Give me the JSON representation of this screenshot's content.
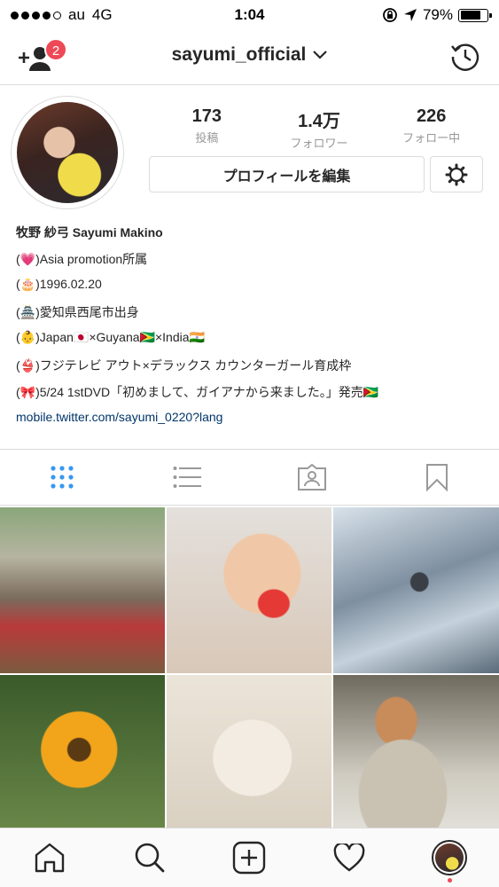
{
  "status_bar": {
    "carrier": "au",
    "network": "4G",
    "time": "1:04",
    "battery": "79%",
    "battery_level": 0.79
  },
  "header": {
    "username": "sayumi_official",
    "pending_count": "2"
  },
  "profile": {
    "stats": [
      {
        "value": "173",
        "label": "投稿"
      },
      {
        "value": "1.4万",
        "label": "フォロワー"
      },
      {
        "value": "226",
        "label": "フォロー中"
      }
    ],
    "edit_label": "プロフィールを編集",
    "name": "牧野 紗弓 Sayumi Makino",
    "bio_lines": [
      "(💗)Asia promotion所属",
      "(🎂)1996.02.20",
      "(🏯)愛知県西尾市出身",
      "(👶)Japan🇯🇵×Guyana🇬🇾×India🇮🇳",
      "(👙)フジテレビ アウト×デラックス カウンターガール育成枠",
      "(🎀)5/24 1stDVD「初めまして、ガイアナから来ました。」発売🇬🇾"
    ],
    "link": "mobile.twitter.com/sayumi_0220?lang"
  },
  "tabs": [
    "grid-icon",
    "list-icon",
    "tagged-icon",
    "saved-icon"
  ],
  "accent_color": "#3897f0",
  "badge_color": "#ed4956"
}
